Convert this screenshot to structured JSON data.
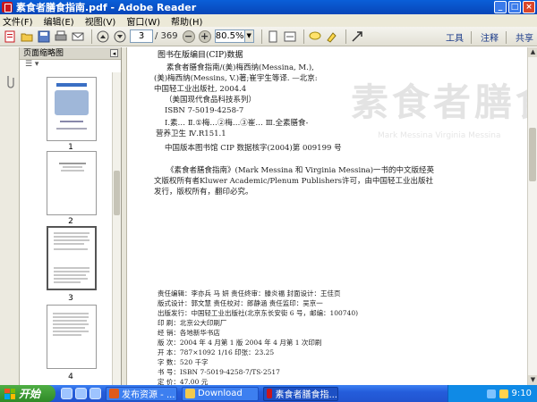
{
  "window": {
    "title": "素食者膳食指南.pdf - Adobe Reader",
    "buttons": {
      "minimize": "_",
      "maximize": "□",
      "close": "×"
    }
  },
  "menu": [
    "文件(F)",
    "编辑(E)",
    "视图(V)",
    "窗口(W)",
    "帮助(H)"
  ],
  "toolbar": {
    "page_current": "3",
    "page_total": "/ 369",
    "zoom_out": "−",
    "zoom_in": "+",
    "zoom": "80.5%",
    "links": [
      "工具",
      "注释",
      "共享"
    ]
  },
  "thumb_panel": {
    "title": "页面缩略图",
    "collapse": "◂",
    "options": "☰ ▾",
    "pages": [
      "1",
      "2",
      "3",
      "4"
    ],
    "selected": "3"
  },
  "document": {
    "watermark": "素食者膳食指",
    "watermark_sub": "Mark Messina  Virginia Messina",
    "lines": [
      "图书在版编目(CIP)数据",
      "素食者膳食指南/(美)梅西纳(Messina, M.),",
      "(美)梅西纳(Messins, V.)著;崔宇生等译. —北京:",
      "中国轻工业出版社, 2004.4",
      "（美国现代食品科技系列）",
      "ISBN 7-5019-4258-7",
      "Ⅰ.素…   Ⅱ.①梅…②梅…③崔…   Ⅲ.全素膳食-",
      "营养卫生   Ⅳ.R151.1",
      "中国版本图书馆 CIP 数据核字(2004)第 009199 号",
      "《素食者膳食指南》(Mark Messina 和 Virginia Messina)一书的中文版经英",
      "文版权所有者Kluwer Academic/Plenum Publishers许可，由中国轻工业出版社",
      "发行，版权所有，翻印必究。",
      "责任编辑：李亦兵   马  妍   责任终审：滕炎福   封面设计：王佳页",
      "版式设计：郭文慧            责任校对：郎静涵   责任监印：吴京一",
      "出版发行：中国轻工业出版社(北京东长安街 6 号，邮编：100740)",
      "印    刷：北京公大印刷厂",
      "经    销：各地新华书店",
      "版    次：2004 年 4 月第 1 版       2004 年 4 月第 1 次印刷",
      "开    本：787×1092    1/16        印张：23.25",
      "字    数：520 千字",
      "书    号：ISBN 7-5019-4258-7/TS·2517",
      "定    价：47.00 元"
    ]
  },
  "taskbar": {
    "start": "开始",
    "tasks": [
      "发布资源 - ...",
      "Download",
      "素食者膳食指..."
    ],
    "time": "9:10"
  },
  "colors": {
    "titlebar": "#0845b8",
    "taskbar": "#245ddb",
    "start": "#2f8a27",
    "tray": "#0f8ae6"
  }
}
